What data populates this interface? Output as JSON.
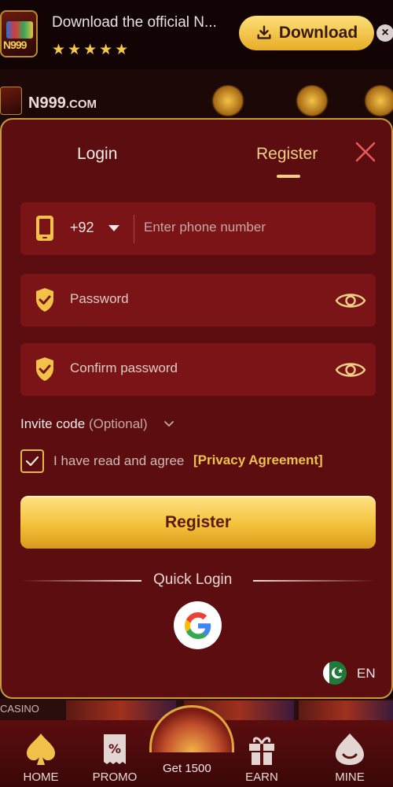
{
  "banner": {
    "text": "Download the official N...",
    "stars": "★★★★★",
    "download_label": "Download",
    "app_icon_label": "N999",
    "close": "×"
  },
  "header": {
    "logo_text": "N999",
    "logo_suffix": ".COM"
  },
  "modal": {
    "tabs": [
      {
        "label": "Login"
      },
      {
        "label": "Register"
      }
    ],
    "phone": {
      "country_code": "+92",
      "placeholder": "Enter phone number"
    },
    "password": {
      "placeholder": "Password"
    },
    "confirm_password": {
      "placeholder": "Confirm password"
    },
    "invite": {
      "label": "Invite code",
      "optional": "(Optional)"
    },
    "agreement": {
      "text": "I have read and agree",
      "link": "[Privacy Agreement]",
      "checked": true
    },
    "register_button": "Register",
    "quick_login": "Quick Login",
    "language": "EN"
  },
  "background": {
    "casino_label": "CASINO"
  },
  "nav": {
    "items": [
      {
        "label": "HOME"
      },
      {
        "label": "PROMO"
      },
      {
        "label": "Get 1500"
      },
      {
        "label": "EARN"
      },
      {
        "label": "MINE"
      }
    ]
  },
  "colors": {
    "modal_bg": "#5b0d0f",
    "field_bg": "#7a1416",
    "accent_gold": "#f1cf86",
    "close_icon": "#e8595a"
  }
}
